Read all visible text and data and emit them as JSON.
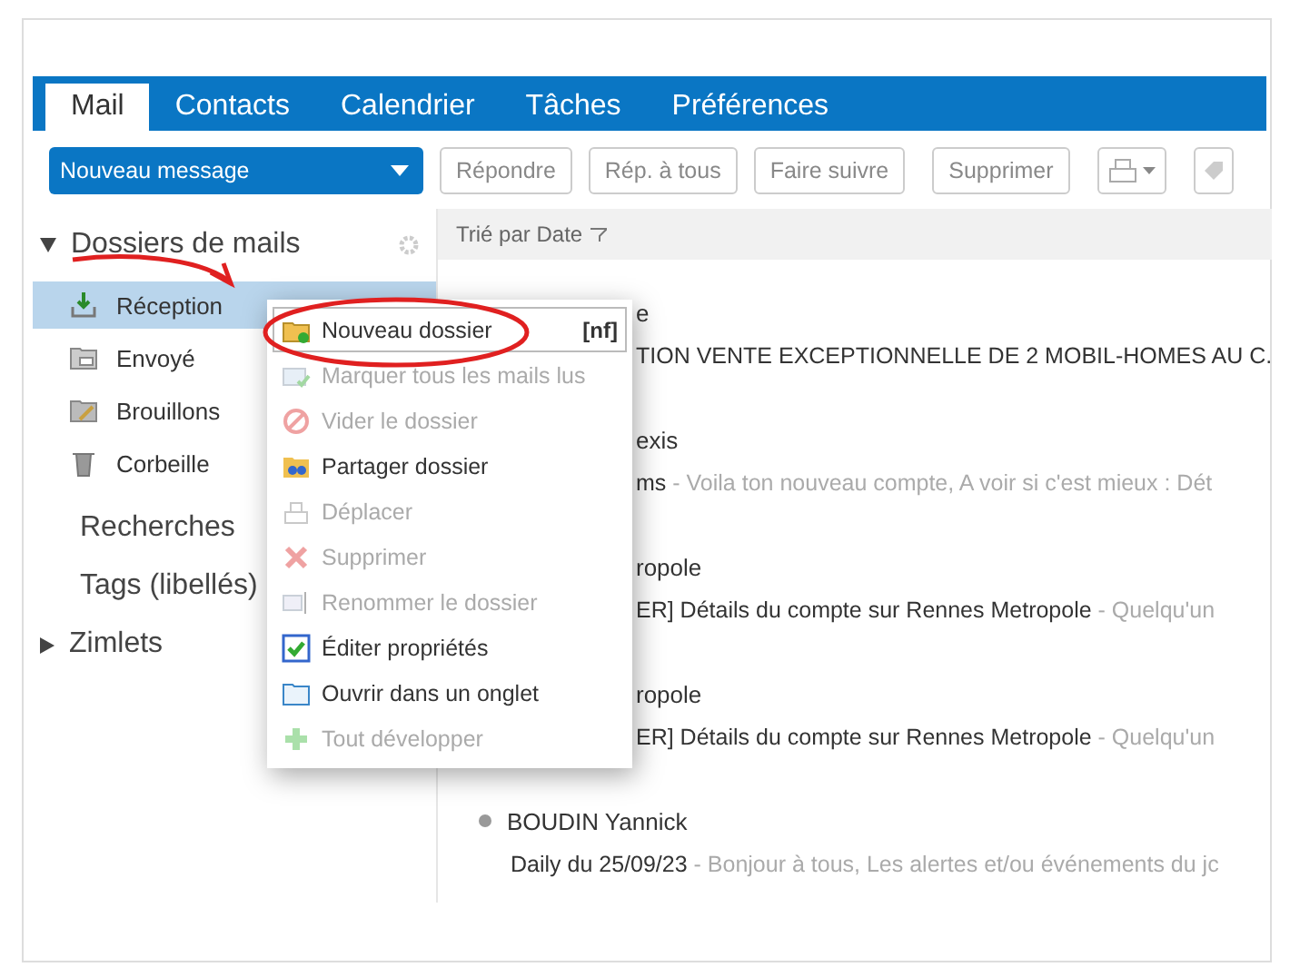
{
  "tabs": [
    {
      "label": "Mail",
      "selected": true
    },
    {
      "label": "Contacts",
      "selected": false
    },
    {
      "label": "Calendrier",
      "selected": false
    },
    {
      "label": "Tâches",
      "selected": false
    },
    {
      "label": "Préférences",
      "selected": false
    }
  ],
  "toolbar": {
    "new_button": "Nouveau message",
    "buttons": [
      "Répondre",
      "Rép. à tous",
      "Faire suivre",
      "Supprimer"
    ]
  },
  "sidebar": {
    "header": "Dossiers de mails",
    "expanded": true,
    "folders": [
      {
        "label": "Réception",
        "selected": true
      },
      {
        "label": "Envoyé",
        "selected": false
      },
      {
        "label": "Brouillons",
        "selected": false
      },
      {
        "label": "Corbeille",
        "selected": false
      }
    ],
    "sections": [
      {
        "label": "Recherches",
        "expandable": false
      },
      {
        "label": "Tags (libellés)",
        "expandable": false
      },
      {
        "label": "Zimlets",
        "expandable": true
      }
    ]
  },
  "list": {
    "sort_label": "Trié par Date",
    "messages": [
      {
        "kind": "covered",
        "sender": "e",
        "subject": "TION VENTE EXCEPTIONNELLE DE 2 MOBIL-HOMES AU C."
      },
      {
        "kind": "covered",
        "sender": "exis",
        "subject": "ms",
        "preview": " - Voila ton nouveau compte, A voir si c'est mieux : Dét"
      },
      {
        "kind": "covered",
        "sender": "ropole",
        "subject": "ER] Détails du compte sur Rennes Metropole",
        "preview": " - Quelqu'un"
      },
      {
        "kind": "covered",
        "sender": "ropole",
        "subject": "ER] Détails du compte sur Rennes Metropole",
        "preview": " - Quelqu'un"
      },
      {
        "kind": "full",
        "sender": "BOUDIN Yannick",
        "subject": "Daily du 25/09/23",
        "preview": " - Bonjour à tous, Les alertes et/ou événements du jc"
      }
    ]
  },
  "context_menu": {
    "items": [
      {
        "label": "Nouveau dossier",
        "shortcut": "[nf]",
        "disabled": false,
        "selected": true
      },
      {
        "label": "Marquer tous les mails lus",
        "disabled": true,
        "selected": false
      },
      {
        "label": "Vider le dossier",
        "disabled": true,
        "selected": false
      },
      {
        "label": "Partager dossier",
        "disabled": false,
        "selected": false
      },
      {
        "label": "Déplacer",
        "disabled": true,
        "selected": false
      },
      {
        "label": "Supprimer",
        "disabled": true,
        "selected": false
      },
      {
        "label": "Renommer le dossier",
        "disabled": true,
        "selected": false
      },
      {
        "label": "Éditer propriétés",
        "disabled": false,
        "selected": false
      },
      {
        "label": "Ouvrir dans un onglet",
        "disabled": false,
        "selected": false
      },
      {
        "label": "Tout développer",
        "disabled": true,
        "selected": false
      }
    ]
  }
}
